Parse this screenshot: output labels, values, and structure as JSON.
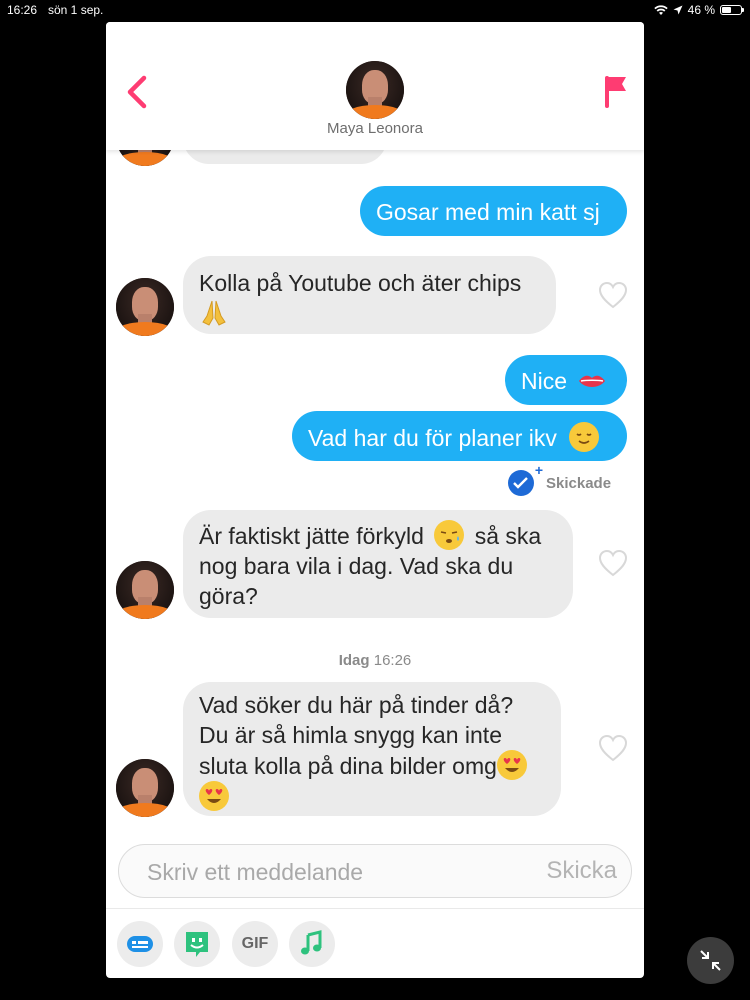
{
  "status_bar": {
    "time": "16:26",
    "date": "sön 1 sep.",
    "battery": "46 %"
  },
  "header": {
    "contact_name": "Maya Leonora"
  },
  "messages": [
    {
      "id": 1,
      "direction": "out",
      "text": "Gosar med min katt sj"
    },
    {
      "id": 2,
      "direction": "in",
      "text": "Kolla på Youtube och äter chips"
    },
    {
      "id": 3,
      "direction": "out",
      "text": "Nice"
    },
    {
      "id": 4,
      "direction": "out",
      "text": "Vad har du för planer ikv"
    },
    {
      "id": 5,
      "direction": "in",
      "line1": "Är faktiskt jätte förkyld",
      "line1b": "så ska",
      "line2": "nog bara vila i dag. Vad ska du",
      "line3": "göra?"
    },
    {
      "id": 6,
      "direction": "in",
      "line1": "Vad söker du här på tinder då?",
      "line2": "Du är så himla snygg kan inte",
      "line3": "sluta kolla på dina bilder omg"
    }
  ],
  "sent_status": "Skickade",
  "timestamp": {
    "day": "Idag",
    "time": "16:26"
  },
  "composer": {
    "placeholder": "Skriv ett meddelande",
    "send_label": "Skicka"
  },
  "toolbar": {
    "gif_label": "GIF"
  },
  "colors": {
    "accent": "#fe3c72",
    "out_bubble": "#1fb0f5",
    "in_bubble": "#ebebeb",
    "check": "#1e6ad6"
  },
  "icons": [
    "back-chevron-icon",
    "flag-icon",
    "heart-icon",
    "double-check-icon",
    "keyboard-shortcut-icon",
    "sticker-icon",
    "music-note-icon",
    "minimize-arrows-icon",
    "wifi-icon",
    "location-icon",
    "battery-icon"
  ]
}
